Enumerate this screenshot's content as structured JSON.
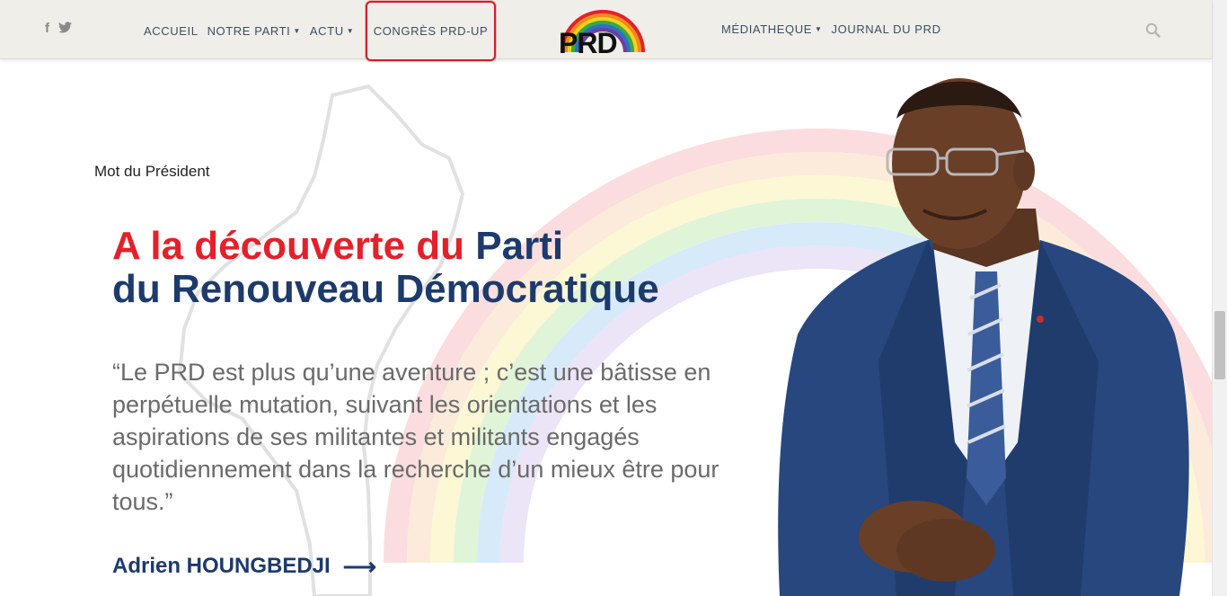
{
  "header": {
    "social": {
      "facebook": "f",
      "twitter": "🐦"
    },
    "nav_left": [
      {
        "label": "ACCUEIL",
        "dropdown": false
      },
      {
        "label": "NOTRE PARTI",
        "dropdown": true
      },
      {
        "label": "ACTU",
        "dropdown": true
      }
    ],
    "nav_highlight": {
      "label": "CONGRÈS PRD-UP"
    },
    "logo": {
      "text": "PRD"
    },
    "nav_right": [
      {
        "label": "MÉDIATHEQUE",
        "dropdown": true
      },
      {
        "label": "JOURNAL DU PRD",
        "dropdown": false
      }
    ],
    "search_icon": "search-icon"
  },
  "hero": {
    "kicker": "Mot du Président",
    "headline": {
      "line1_red": "A la découverte du ",
      "line1_blue": "Parti",
      "line2": "du Renouveau Démocratique"
    },
    "quote": "“Le PRD est plus qu’une aventure ; c’est une bâtisse en perpétuelle mutation, suivant les orientations et les aspirations de ses militantes et militants engagés quotidiennement dans la recherche d’un mieux être pour tous.”",
    "author": "Adrien HOUNGBEDJI",
    "arrow": "⟶"
  },
  "colors": {
    "accent_red": "#e3212b",
    "navy": "#1d3a6b",
    "header_bg": "#efeee9",
    "highlight_border": "#d11d28"
  }
}
